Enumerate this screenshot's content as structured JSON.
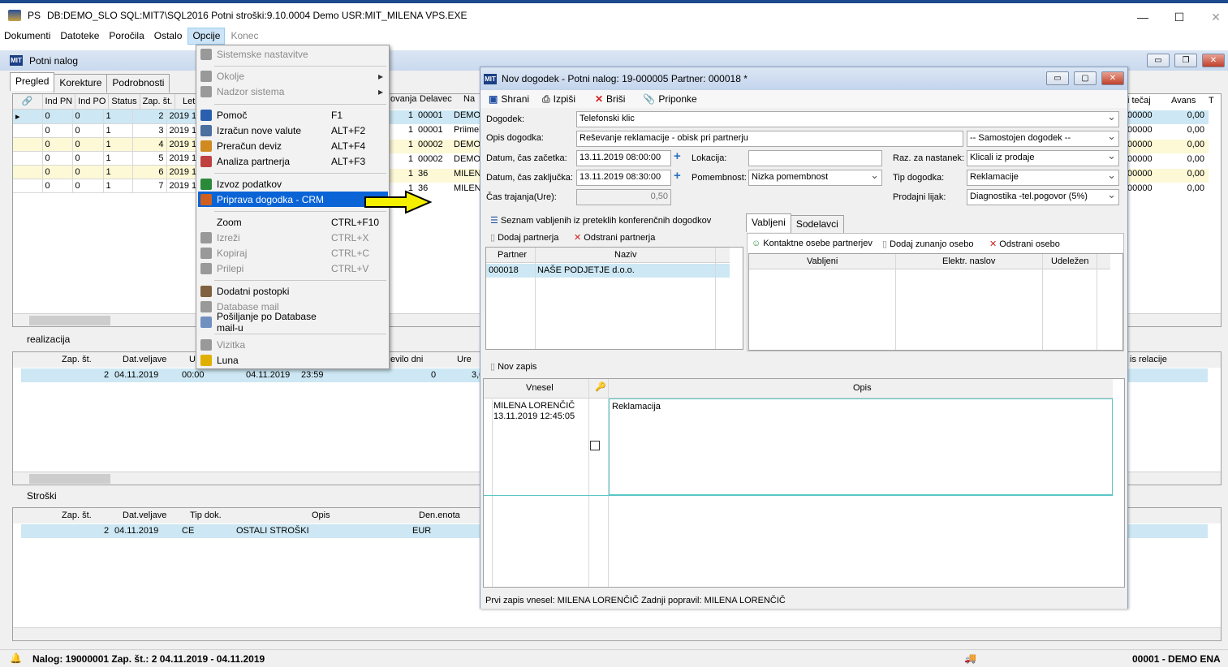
{
  "titlebar": {
    "app": "PS",
    "text": "DB:DEMO_SLO   SQL:MIT7\\SQL2016   Potni stroški:9.10.0004   Demo   USR:MIT_MILENA   VPS.EXE"
  },
  "menubar": {
    "items": [
      "Dokumenti",
      "Datoteke",
      "Poročila",
      "Ostalo",
      "Opcije",
      "Konec"
    ]
  },
  "child": {
    "title": "Potni nalog",
    "tabs": [
      "Pregled",
      "Korekture",
      "Podrobnosti"
    ]
  },
  "main_grid": {
    "headers": [
      "",
      "Ind PN",
      "Ind PO",
      "Status",
      "Zap. št.",
      "Leto"
    ],
    "headers_right": [
      "ovanja",
      "Delavec",
      "Na"
    ],
    "headers_far": [
      "i tečaj",
      "Avans",
      "T"
    ],
    "rows": [
      [
        "0",
        "0",
        "1",
        "2",
        "2019 1",
        "1",
        "00001",
        "DEMO",
        "00000",
        "0,00"
      ],
      [
        "0",
        "0",
        "1",
        "3",
        "2019 1",
        "1",
        "00001",
        "Priimek",
        "00000",
        "0,00"
      ],
      [
        "0",
        "0",
        "1",
        "4",
        "2019 1",
        "1",
        "00002",
        "DEMO",
        "00000",
        "0,00"
      ],
      [
        "0",
        "0",
        "1",
        "5",
        "2019 1",
        "1",
        "00002",
        "DEMO",
        "00000",
        "0,00"
      ],
      [
        "0",
        "0",
        "1",
        "6",
        "2019 1",
        "1",
        "36",
        "MILEN",
        "00000",
        "0,00"
      ],
      [
        "0",
        "0",
        "1",
        "7",
        "2019 1",
        "1",
        "36",
        "MILEN",
        "00000",
        "0,00"
      ]
    ]
  },
  "realizacija": {
    "label": "realizacija",
    "headers": [
      "Zap. št.",
      "Dat.veljave",
      "U"
    ],
    "headers_right": [
      "evilo dni",
      "Ure"
    ],
    "header_far": "is relacije",
    "row": [
      "2",
      "04.11.2019",
      "00:00",
      "04.11.2019",
      "23:59",
      "0",
      "3,0"
    ]
  },
  "stroski": {
    "label": "Stroški",
    "headers": [
      "Zap. št.",
      "Dat.veljave",
      "Tip dok.",
      "Opis",
      "Den.enota"
    ],
    "row": [
      "2",
      "04.11.2019",
      "CE",
      "OSTALI STROŠKI",
      "EUR"
    ]
  },
  "context_menu": {
    "items": [
      {
        "label": "Sistemske nastavitve",
        "shortcut": "",
        "disabled": true
      },
      {
        "label": "Okolje",
        "shortcut": "",
        "disabled": true,
        "submenu": true
      },
      {
        "label": "Nadzor sistema",
        "shortcut": "",
        "disabled": true,
        "submenu": true
      },
      {
        "label": "Pomoč",
        "shortcut": "F1"
      },
      {
        "label": "Izračun nove valute",
        "shortcut": "ALT+F2"
      },
      {
        "label": "Preračun deviz",
        "shortcut": "ALT+F4"
      },
      {
        "label": "Analiza partnerja",
        "shortcut": "ALT+F3"
      },
      {
        "label": "Izvoz podatkov",
        "shortcut": ""
      },
      {
        "label": "Priprava dogodka - CRM",
        "shortcut": "",
        "highlighted": true
      },
      {
        "label": "Zoom",
        "shortcut": "CTRL+F10"
      },
      {
        "label": "Izreži",
        "shortcut": "CTRL+X",
        "disabled": true
      },
      {
        "label": "Kopiraj",
        "shortcut": "CTRL+C",
        "disabled": true
      },
      {
        "label": "Prilepi",
        "shortcut": "CTRL+V",
        "disabled": true
      },
      {
        "label": "Dodatni postopki",
        "shortcut": ""
      },
      {
        "label": "Database mail",
        "shortcut": "",
        "disabled": true
      },
      {
        "label": "Pošiljanje po Database mail-u",
        "shortcut": ""
      },
      {
        "label": "Vizitka",
        "shortcut": "",
        "disabled": true
      },
      {
        "label": "Luna",
        "shortcut": ""
      }
    ]
  },
  "dialog": {
    "title": "Nov dogodek - Potni nalog: 19-000005   Partner: 000018 *",
    "toolbar": [
      "Shrani",
      "Izpiši",
      "Briši",
      "Priponke"
    ],
    "fields": {
      "dogodek_label": "Dogodek:",
      "dogodek": "Telefonski klic",
      "opis_label": "Opis dogodka:",
      "opis": "Reševanje reklamacije - obisk pri partnerju",
      "samostojen": "-- Samostojen dogodek --",
      "zacetek_label": "Datum, čas začetka:",
      "zacetek": "13.11.2019 08:00:00",
      "konec_label": "Datum, čas zaključka:",
      "konec": "13.11.2019 08:30:00",
      "trajanje_label": "Čas trajanja(Ure):",
      "trajanje": "0,50",
      "lokacija_label": "Lokacija:",
      "lokacija": "",
      "pomembnost_label": "Pomembnost:",
      "pomembnost": "Nizka pomembnost",
      "razlog_label": "Raz. za nastanek:",
      "razlog": "Klicali iz prodaje",
      "tip_label": "Tip dogodka:",
      "tip": "Reklamacije",
      "lijak_label": "Prodajni lijak:",
      "lijak": "Diagnostika -tel.pogovor (5%)"
    },
    "seznam": "Seznam vabljenih iz preteklih konferenčnih dogodkov",
    "dodaj_partnerja": "Dodaj partnerja",
    "odstrani_partnerja": "Odstrani partnerja",
    "partner_headers": [
      "Partner",
      "Naziv"
    ],
    "partner_row": [
      "000018",
      "NAŠE PODJETJE d.o.o."
    ],
    "inv_tabs": [
      "Vabljeni",
      "Sodelavci"
    ],
    "kontaktne": "Kontaktne osebe partnerjev",
    "dodaj_zunanjo": "Dodaj zunanjo osebo",
    "odstrani_osebo": "Odstrani osebo",
    "inv_headers": [
      "Vabljeni",
      "Elektr. naslov",
      "Udeležen"
    ],
    "nov_zapis": "Nov zapis",
    "notes_headers": [
      "Vnesel",
      "Opis"
    ],
    "note": {
      "author": "MILENA LORENČIČ",
      "date": "13.11.2019 12:45:05",
      "text": "Reklamacija"
    },
    "footer": "Prvi zapis vnesel: MILENA LORENČIČ Zadnji popravil: MILENA LORENČIČ"
  },
  "statusbar": {
    "left": "Nalog: 19000001  Zap. št.: 2    04.11.2019 - 04.11.2019",
    "right": "00001 - DEMO ENA"
  },
  "colors": {
    "highlight": "#0a64d6",
    "selected_row": "#cde8f4",
    "yellow_row": "#fdf8d6",
    "arrow": "#f5f000"
  }
}
